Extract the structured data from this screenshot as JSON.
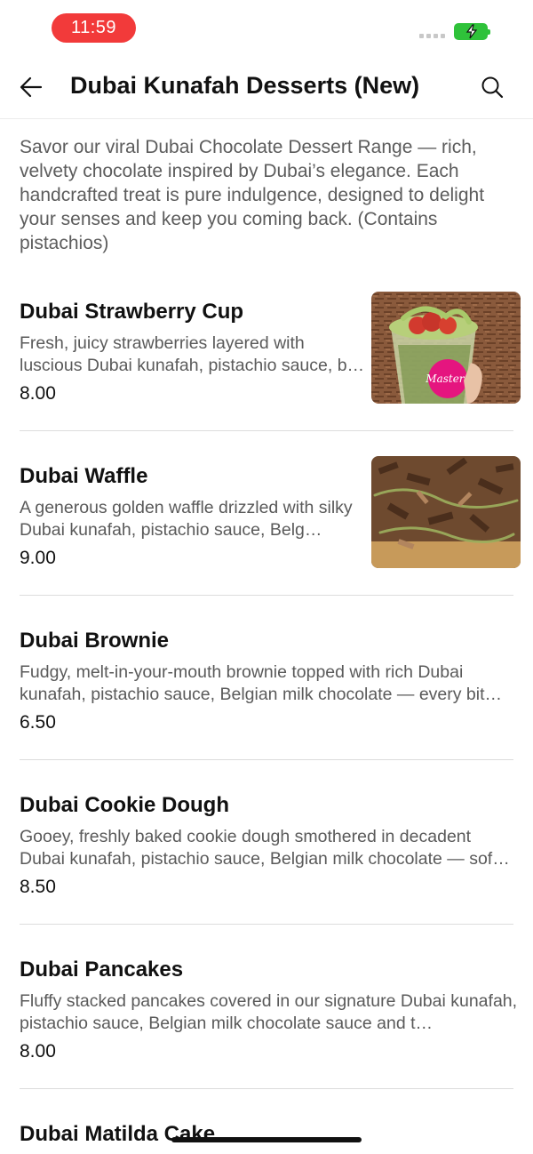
{
  "status": {
    "time": "11:59"
  },
  "header": {
    "title": "Dubai Kunafah Desserts (New)"
  },
  "category": {
    "description": "Savor our viral Dubai Chocolate Dessert Range — rich, velvety chocolate inspired by Dubai’s elegance. Each handcrafted treat is pure indulgence, designed to delight your senses and keep you coming back. (Contains pistachios)"
  },
  "items": [
    {
      "name": "Dubai Strawberry Cup",
      "description": "Fresh, juicy strawberries layered with luscious Dubai kunafah, pistachio sauce, b…",
      "price": "8.00",
      "image": "strawberry-cup-photo",
      "cup_text": "Masters"
    },
    {
      "name": "Dubai Waffle",
      "description": "A generous golden waffle drizzled with silky Dubai kunafah, pistachio sauce, Belg…",
      "price": "9.00",
      "image": "waffle-photo"
    },
    {
      "name": "Dubai Brownie",
      "description": "Fudgy, melt-in-your-mouth brownie topped with rich Dubai kunafah, pistachio sauce, Belgian milk chocolate — every bit…",
      "price": "6.50"
    },
    {
      "name": "Dubai Cookie Dough",
      "description": "Gooey, freshly baked cookie dough smothered in decadent Dubai kunafah, pistachio sauce, Belgian milk chocolate — sof…",
      "price": "8.50"
    },
    {
      "name": "Dubai Pancakes",
      "description": "Fluffy stacked pancakes covered in our signature Dubai kunafah, pistachio sauce, Belgian milk chocolate sauce and t…",
      "price": "8.00"
    },
    {
      "name": "Dubai Matilda Cake"
    }
  ],
  "icons": {
    "back": "arrow-left-icon",
    "search": "search-icon",
    "battery": "battery-charging-icon"
  },
  "colors": {
    "accent": "#f23a3a",
    "battery": "#2fc23a",
    "text_secondary": "#5a5a5a"
  }
}
